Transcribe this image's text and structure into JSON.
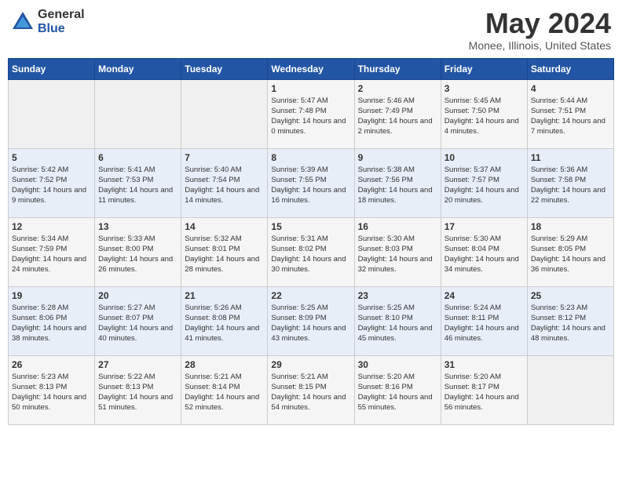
{
  "header": {
    "logo_general": "General",
    "logo_blue": "Blue",
    "month_title": "May 2024",
    "location": "Monee, Illinois, United States"
  },
  "days_of_week": [
    "Sunday",
    "Monday",
    "Tuesday",
    "Wednesday",
    "Thursday",
    "Friday",
    "Saturday"
  ],
  "weeks": [
    [
      {
        "day": "",
        "sunrise": "",
        "sunset": "",
        "daylight": ""
      },
      {
        "day": "",
        "sunrise": "",
        "sunset": "",
        "daylight": ""
      },
      {
        "day": "",
        "sunrise": "",
        "sunset": "",
        "daylight": ""
      },
      {
        "day": "1",
        "sunrise": "Sunrise: 5:47 AM",
        "sunset": "Sunset: 7:48 PM",
        "daylight": "Daylight: 14 hours and 0 minutes."
      },
      {
        "day": "2",
        "sunrise": "Sunrise: 5:46 AM",
        "sunset": "Sunset: 7:49 PM",
        "daylight": "Daylight: 14 hours and 2 minutes."
      },
      {
        "day": "3",
        "sunrise": "Sunrise: 5:45 AM",
        "sunset": "Sunset: 7:50 PM",
        "daylight": "Daylight: 14 hours and 4 minutes."
      },
      {
        "day": "4",
        "sunrise": "Sunrise: 5:44 AM",
        "sunset": "Sunset: 7:51 PM",
        "daylight": "Daylight: 14 hours and 7 minutes."
      }
    ],
    [
      {
        "day": "5",
        "sunrise": "Sunrise: 5:42 AM",
        "sunset": "Sunset: 7:52 PM",
        "daylight": "Daylight: 14 hours and 9 minutes."
      },
      {
        "day": "6",
        "sunrise": "Sunrise: 5:41 AM",
        "sunset": "Sunset: 7:53 PM",
        "daylight": "Daylight: 14 hours and 11 minutes."
      },
      {
        "day": "7",
        "sunrise": "Sunrise: 5:40 AM",
        "sunset": "Sunset: 7:54 PM",
        "daylight": "Daylight: 14 hours and 14 minutes."
      },
      {
        "day": "8",
        "sunrise": "Sunrise: 5:39 AM",
        "sunset": "Sunset: 7:55 PM",
        "daylight": "Daylight: 14 hours and 16 minutes."
      },
      {
        "day": "9",
        "sunrise": "Sunrise: 5:38 AM",
        "sunset": "Sunset: 7:56 PM",
        "daylight": "Daylight: 14 hours and 18 minutes."
      },
      {
        "day": "10",
        "sunrise": "Sunrise: 5:37 AM",
        "sunset": "Sunset: 7:57 PM",
        "daylight": "Daylight: 14 hours and 20 minutes."
      },
      {
        "day": "11",
        "sunrise": "Sunrise: 5:36 AM",
        "sunset": "Sunset: 7:58 PM",
        "daylight": "Daylight: 14 hours and 22 minutes."
      }
    ],
    [
      {
        "day": "12",
        "sunrise": "Sunrise: 5:34 AM",
        "sunset": "Sunset: 7:59 PM",
        "daylight": "Daylight: 14 hours and 24 minutes."
      },
      {
        "day": "13",
        "sunrise": "Sunrise: 5:33 AM",
        "sunset": "Sunset: 8:00 PM",
        "daylight": "Daylight: 14 hours and 26 minutes."
      },
      {
        "day": "14",
        "sunrise": "Sunrise: 5:32 AM",
        "sunset": "Sunset: 8:01 PM",
        "daylight": "Daylight: 14 hours and 28 minutes."
      },
      {
        "day": "15",
        "sunrise": "Sunrise: 5:31 AM",
        "sunset": "Sunset: 8:02 PM",
        "daylight": "Daylight: 14 hours and 30 minutes."
      },
      {
        "day": "16",
        "sunrise": "Sunrise: 5:30 AM",
        "sunset": "Sunset: 8:03 PM",
        "daylight": "Daylight: 14 hours and 32 minutes."
      },
      {
        "day": "17",
        "sunrise": "Sunrise: 5:30 AM",
        "sunset": "Sunset: 8:04 PM",
        "daylight": "Daylight: 14 hours and 34 minutes."
      },
      {
        "day": "18",
        "sunrise": "Sunrise: 5:29 AM",
        "sunset": "Sunset: 8:05 PM",
        "daylight": "Daylight: 14 hours and 36 minutes."
      }
    ],
    [
      {
        "day": "19",
        "sunrise": "Sunrise: 5:28 AM",
        "sunset": "Sunset: 8:06 PM",
        "daylight": "Daylight: 14 hours and 38 minutes."
      },
      {
        "day": "20",
        "sunrise": "Sunrise: 5:27 AM",
        "sunset": "Sunset: 8:07 PM",
        "daylight": "Daylight: 14 hours and 40 minutes."
      },
      {
        "day": "21",
        "sunrise": "Sunrise: 5:26 AM",
        "sunset": "Sunset: 8:08 PM",
        "daylight": "Daylight: 14 hours and 41 minutes."
      },
      {
        "day": "22",
        "sunrise": "Sunrise: 5:25 AM",
        "sunset": "Sunset: 8:09 PM",
        "daylight": "Daylight: 14 hours and 43 minutes."
      },
      {
        "day": "23",
        "sunrise": "Sunrise: 5:25 AM",
        "sunset": "Sunset: 8:10 PM",
        "daylight": "Daylight: 14 hours and 45 minutes."
      },
      {
        "day": "24",
        "sunrise": "Sunrise: 5:24 AM",
        "sunset": "Sunset: 8:11 PM",
        "daylight": "Daylight: 14 hours and 46 minutes."
      },
      {
        "day": "25",
        "sunrise": "Sunrise: 5:23 AM",
        "sunset": "Sunset: 8:12 PM",
        "daylight": "Daylight: 14 hours and 48 minutes."
      }
    ],
    [
      {
        "day": "26",
        "sunrise": "Sunrise: 5:23 AM",
        "sunset": "Sunset: 8:13 PM",
        "daylight": "Daylight: 14 hours and 50 minutes."
      },
      {
        "day": "27",
        "sunrise": "Sunrise: 5:22 AM",
        "sunset": "Sunset: 8:13 PM",
        "daylight": "Daylight: 14 hours and 51 minutes."
      },
      {
        "day": "28",
        "sunrise": "Sunrise: 5:21 AM",
        "sunset": "Sunset: 8:14 PM",
        "daylight": "Daylight: 14 hours and 52 minutes."
      },
      {
        "day": "29",
        "sunrise": "Sunrise: 5:21 AM",
        "sunset": "Sunset: 8:15 PM",
        "daylight": "Daylight: 14 hours and 54 minutes."
      },
      {
        "day": "30",
        "sunrise": "Sunrise: 5:20 AM",
        "sunset": "Sunset: 8:16 PM",
        "daylight": "Daylight: 14 hours and 55 minutes."
      },
      {
        "day": "31",
        "sunrise": "Sunrise: 5:20 AM",
        "sunset": "Sunset: 8:17 PM",
        "daylight": "Daylight: 14 hours and 56 minutes."
      },
      {
        "day": "",
        "sunrise": "",
        "sunset": "",
        "daylight": ""
      }
    ]
  ]
}
